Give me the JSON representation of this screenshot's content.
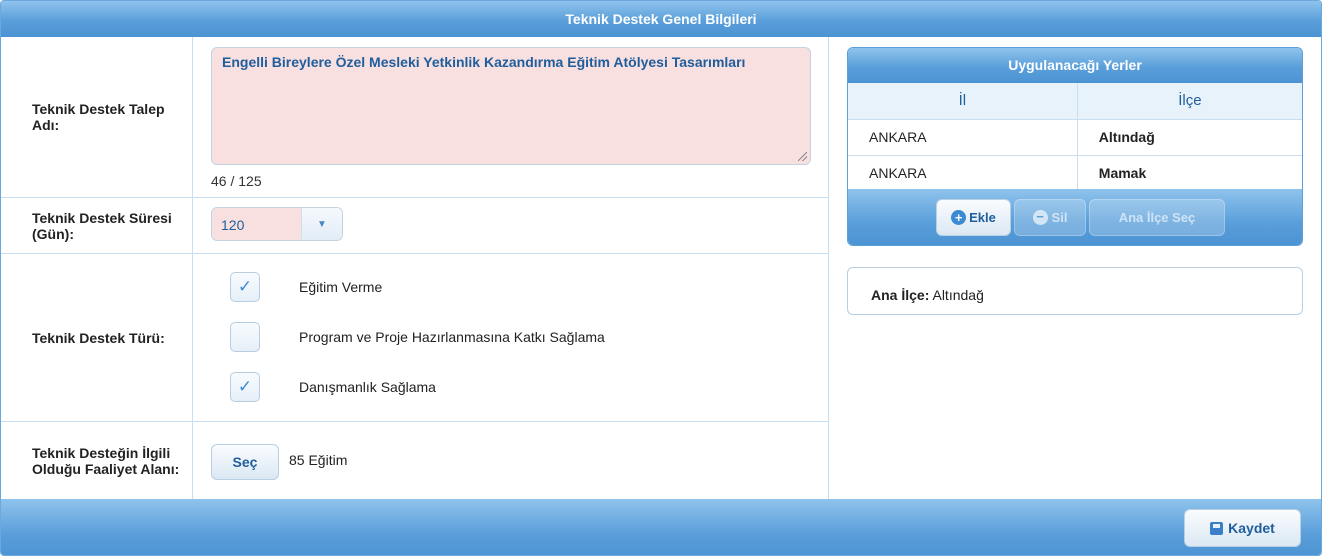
{
  "panel": {
    "title": "Teknik Destek Genel Bilgileri"
  },
  "form": {
    "name_label": "Teknik Destek Talep Adı:",
    "name_value": "Engelli Bireylere Özel Mesleki Yetkinlik Kazandırma Eğitim Atölyesi Tasarımları",
    "name_counter": "46 / 125",
    "duration_label": "Teknik Destek Süresi (Gün):",
    "duration_value": "120",
    "type_label": "Teknik Destek Türü:",
    "types": [
      {
        "label": "Eğitim Verme",
        "checked": true
      },
      {
        "label": "Program ve Proje Hazırlanmasına Katkı Sağlama",
        "checked": false
      },
      {
        "label": "Danışmanlık Sağlama",
        "checked": true
      }
    ],
    "activity_label": "Teknik Desteğin İlgili Olduğu Faaliyet Alanı:",
    "activity_button": "Seç",
    "activity_value": "85 Eğitim"
  },
  "locations": {
    "title": "Uygulanacağı Yerler",
    "columns": [
      "İl",
      "İlçe"
    ],
    "rows": [
      {
        "il": "ANKARA",
        "ilce": "Altındağ"
      },
      {
        "il": "ANKARA",
        "ilce": "Mamak"
      }
    ],
    "add_label": "Ekle",
    "delete_label": "Sil",
    "main_district_button": "Ana İlçe Seç"
  },
  "main_district": {
    "label": "Ana İlçe:",
    "value": "Altındağ"
  },
  "footer": {
    "save_label": "Kaydet"
  },
  "colors": {
    "header_blue": "#5a9fda",
    "text_blue": "#1f5e9c",
    "invalid_pink": "#f8dfe0",
    "check_blue": "#3a8ad4"
  },
  "icons": {
    "check": "check-icon",
    "dropdown": "chevron-down-icon",
    "add": "plus-circle-icon",
    "delete": "minus-circle-icon",
    "save": "save-icon"
  }
}
